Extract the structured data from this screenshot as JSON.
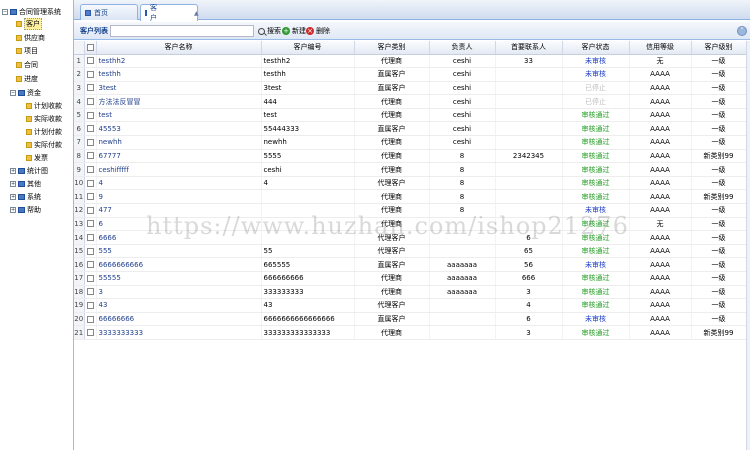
{
  "sidebar": {
    "root_label": "合同管理系统",
    "items": [
      {
        "label": "客户",
        "selected": true
      },
      {
        "label": "供应商"
      },
      {
        "label": "项目"
      },
      {
        "label": "合同"
      },
      {
        "label": "进度"
      }
    ],
    "fund_group": {
      "label": "资金",
      "children": [
        "计划收款",
        "实际收款",
        "计划付款",
        "实际付款",
        "发票"
      ]
    },
    "other_groups": [
      "统计图",
      "其他",
      "系统",
      "帮助"
    ]
  },
  "tabs": [
    {
      "label": "首页",
      "active": false
    },
    {
      "label": "客户",
      "active": true
    }
  ],
  "toolbar": {
    "title": "客户列表",
    "search_value": "",
    "search_label": "搜索",
    "add_label": "新建",
    "delete_label": "删除"
  },
  "grid": {
    "columns": [
      "客户名称",
      "客户编号",
      "客户类别",
      "负责人",
      "首要联系人",
      "客户状态",
      "信用等级",
      "客户级别"
    ],
    "rows": [
      {
        "n": "1",
        "name": "testhh2",
        "code": "testhh2",
        "type": "代理商",
        "owner": "ceshi",
        "contact": "33",
        "status": "未审核",
        "st": "pending",
        "credit": "无",
        "level": "一级"
      },
      {
        "n": "2",
        "name": "testhh",
        "code": "testhh",
        "type": "直属客户",
        "owner": "ceshi",
        "contact": "",
        "status": "未审核",
        "st": "pending",
        "credit": "AAAA",
        "level": "一级"
      },
      {
        "n": "3",
        "name": "3test",
        "code": "3test",
        "type": "直属客户",
        "owner": "ceshi",
        "contact": "",
        "status": "已停止",
        "st": "other",
        "credit": "AAAA",
        "level": "一级"
      },
      {
        "n": "4",
        "name": "方法法反冒冒",
        "code": "444",
        "type": "代理商",
        "owner": "ceshi",
        "contact": "",
        "status": "已停止",
        "st": "other",
        "credit": "AAAA",
        "level": "一级"
      },
      {
        "n": "5",
        "name": "test",
        "code": "test",
        "type": "代理商",
        "owner": "ceshi",
        "contact": "",
        "status": "审核通过",
        "st": "passed",
        "credit": "AAAA",
        "level": "一级"
      },
      {
        "n": "6",
        "name": "45553",
        "code": "55444333",
        "type": "直属客户",
        "owner": "ceshi",
        "contact": "",
        "status": "审核通过",
        "st": "passed",
        "credit": "AAAA",
        "level": "一级"
      },
      {
        "n": "7",
        "name": "newhh",
        "code": "newhh",
        "type": "代理商",
        "owner": "ceshi",
        "contact": "",
        "status": "审核通过",
        "st": "passed",
        "credit": "AAAA",
        "level": "一级"
      },
      {
        "n": "8",
        "name": "67777",
        "code": "5555",
        "type": "代理商",
        "owner": "8",
        "contact": "2342345",
        "status": "审核通过",
        "st": "passed",
        "credit": "AAAA",
        "level": "新类别99"
      },
      {
        "n": "9",
        "name": "ceshifffff",
        "code": "ceshi",
        "type": "代理商",
        "owner": "8",
        "contact": "",
        "status": "审核通过",
        "st": "passed",
        "credit": "AAAA",
        "level": "一级"
      },
      {
        "n": "10",
        "name": "4",
        "code": "4",
        "type": "代理客户",
        "owner": "8",
        "contact": "",
        "status": "审核通过",
        "st": "passed",
        "credit": "AAAA",
        "level": "一级"
      },
      {
        "n": "11",
        "name": "9",
        "code": "",
        "type": "代理商",
        "owner": "8",
        "contact": "",
        "status": "审核通过",
        "st": "passed",
        "credit": "AAAA",
        "level": "新类别99"
      },
      {
        "n": "12",
        "name": "477",
        "code": "",
        "type": "代理商",
        "owner": "8",
        "contact": "",
        "status": "未审核",
        "st": "pending",
        "credit": "AAAA",
        "level": "一级"
      },
      {
        "n": "13",
        "name": "6",
        "code": "",
        "type": "代理商",
        "owner": "",
        "contact": "",
        "status": "审核通过",
        "st": "passed",
        "credit": "无",
        "level": "一级"
      },
      {
        "n": "14",
        "name": "6666",
        "code": "",
        "type": "代理客户",
        "owner": "",
        "contact": "6",
        "status": "审核通过",
        "st": "passed",
        "credit": "AAAA",
        "level": "一级"
      },
      {
        "n": "15",
        "name": "555",
        "code": "55",
        "type": "代理客户",
        "owner": "",
        "contact": "65",
        "status": "审核通过",
        "st": "passed",
        "credit": "AAAA",
        "level": "一级"
      },
      {
        "n": "16",
        "name": "6666666666",
        "code": "665555",
        "type": "直属客户",
        "owner": "aaaaaaa",
        "contact": "56",
        "status": "未审核",
        "st": "pending",
        "credit": "AAAA",
        "level": "一级"
      },
      {
        "n": "17",
        "name": "55555",
        "code": "666666666",
        "type": "代理商",
        "owner": "aaaaaaa",
        "contact": "666",
        "status": "审核通过",
        "st": "passed",
        "credit": "AAAA",
        "level": "一级"
      },
      {
        "n": "18",
        "name": "3",
        "code": "333333333",
        "type": "代理商",
        "owner": "aaaaaaa",
        "contact": "3",
        "status": "审核通过",
        "st": "passed",
        "credit": "AAAA",
        "level": "一级"
      },
      {
        "n": "19",
        "name": "43",
        "code": "43",
        "type": "代理客户",
        "owner": "",
        "contact": "4",
        "status": "审核通过",
        "st": "passed",
        "credit": "AAAA",
        "level": "一级"
      },
      {
        "n": "20",
        "name": "66666666",
        "code": "6666666666666666",
        "type": "直属客户",
        "owner": "",
        "contact": "6",
        "status": "未审核",
        "st": "pending",
        "credit": "AAAA",
        "level": "一级"
      },
      {
        "n": "21",
        "name": "3333333333",
        "code": "333333333333333",
        "type": "代理商",
        "owner": "",
        "contact": "3",
        "status": "审核通过",
        "st": "passed",
        "credit": "AAAA",
        "level": "新类别99"
      }
    ]
  },
  "watermark": "https://www.huzhan.com/ishop21276"
}
